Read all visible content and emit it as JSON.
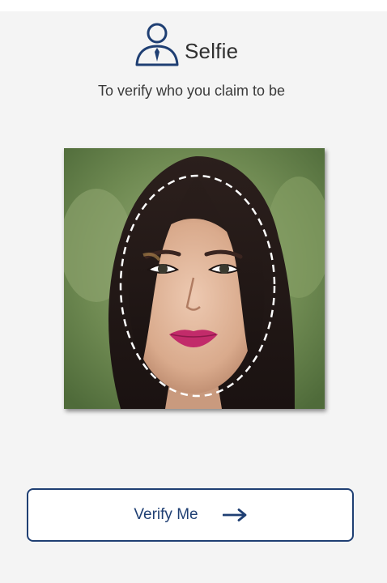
{
  "header": {
    "icon": "person-with-tie-icon",
    "title": "Selfie"
  },
  "subtitle": "To verify who you claim to be",
  "selfie": {
    "image": "face-portrait-photo",
    "guide": "dashed-oval-face-guide"
  },
  "verify_button": {
    "label": "Verify Me",
    "icon": "arrow-right-icon"
  },
  "colors": {
    "accent": "#1f3f73",
    "background": "#f4f4f4",
    "text": "#2f2f2f"
  }
}
